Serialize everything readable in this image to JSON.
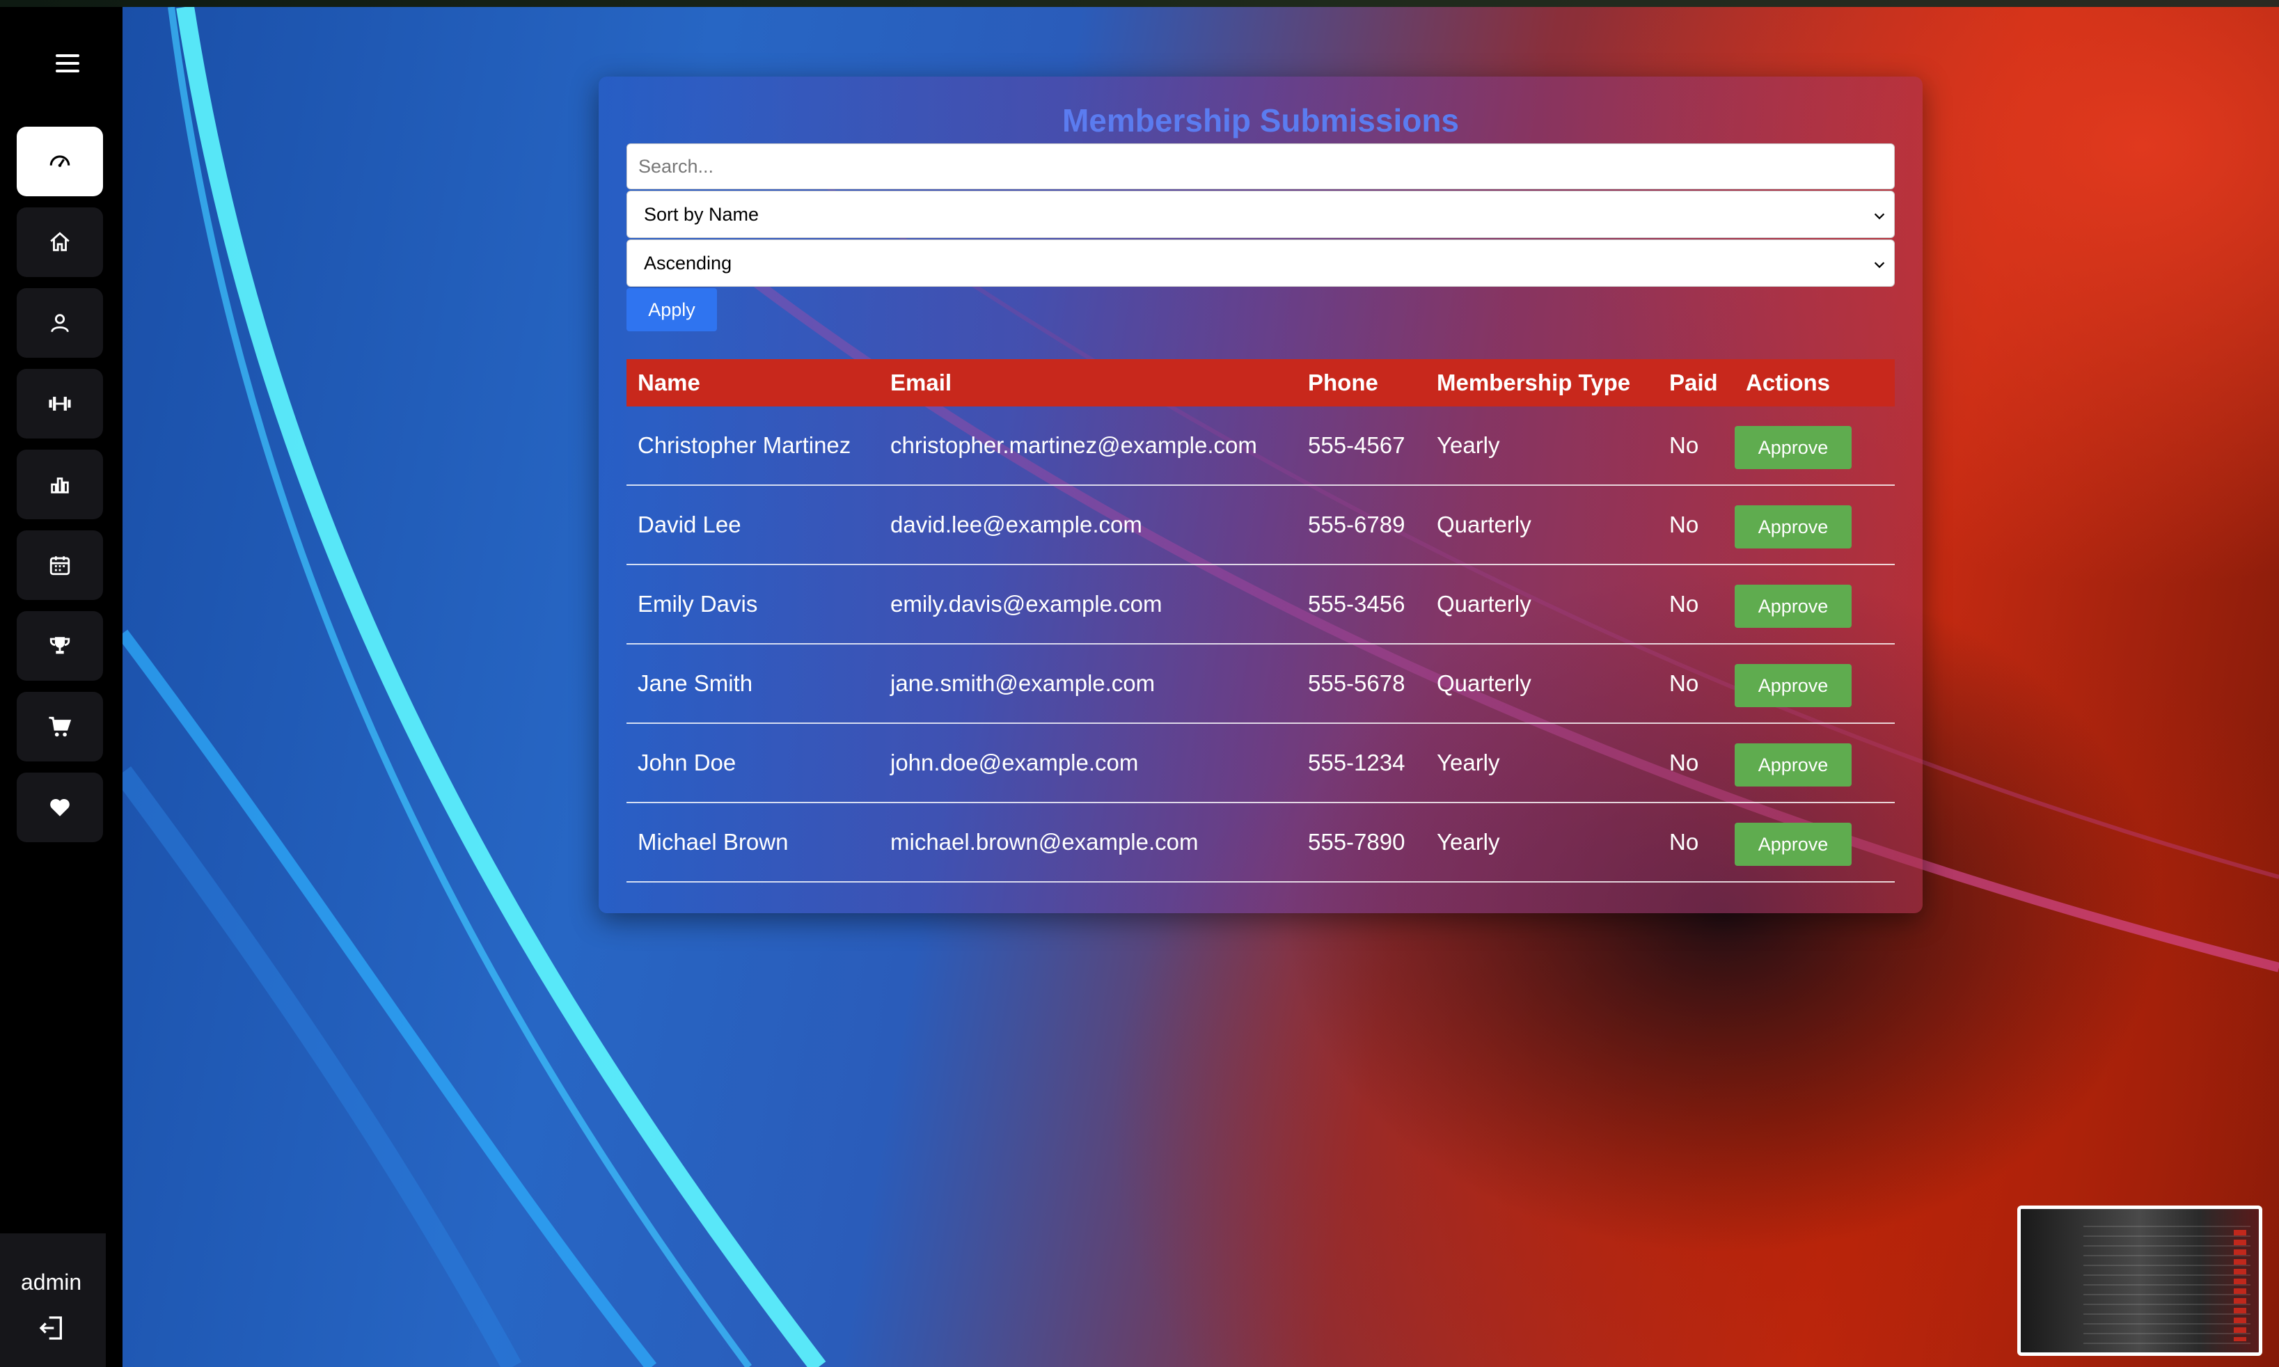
{
  "sidebar": {
    "items": [
      {
        "icon": "dashboard-icon"
      },
      {
        "icon": "home-icon"
      },
      {
        "icon": "user-icon"
      },
      {
        "icon": "dumbbell-icon"
      },
      {
        "icon": "bar-chart-icon"
      },
      {
        "icon": "calendar-icon"
      },
      {
        "icon": "trophy-icon"
      },
      {
        "icon": "cart-icon"
      },
      {
        "icon": "heart-icon"
      }
    ],
    "user": "admin"
  },
  "card": {
    "title": "Membership Submissions",
    "search_placeholder": "Search...",
    "sort_field": "Sort by Name",
    "sort_order": "Ascending",
    "apply_label": "Apply"
  },
  "table": {
    "columns": [
      "Name",
      "Email",
      "Phone",
      "Membership Type",
      "Paid",
      "Actions"
    ],
    "rows": [
      {
        "name": "Christopher Martinez",
        "email": "christopher.martinez@example.com",
        "phone": "555-4567",
        "type": "Yearly",
        "paid": "No",
        "action": "Approve"
      },
      {
        "name": "David Lee",
        "email": "david.lee@example.com",
        "phone": "555-6789",
        "type": "Quarterly",
        "paid": "No",
        "action": "Approve"
      },
      {
        "name": "Emily Davis",
        "email": "emily.davis@example.com",
        "phone": "555-3456",
        "type": "Quarterly",
        "paid": "No",
        "action": "Approve"
      },
      {
        "name": "Jane Smith",
        "email": "jane.smith@example.com",
        "phone": "555-5678",
        "type": "Quarterly",
        "paid": "No",
        "action": "Approve"
      },
      {
        "name": "John Doe",
        "email": "john.doe@example.com",
        "phone": "555-1234",
        "type": "Yearly",
        "paid": "No",
        "action": "Approve"
      },
      {
        "name": "Michael Brown",
        "email": "michael.brown@example.com",
        "phone": "555-7890",
        "type": "Yearly",
        "paid": "No",
        "action": "Approve"
      }
    ]
  },
  "colors": {
    "title": "#5b7cf0",
    "header_bg": "#c8281c",
    "apply_bg": "#2f74f0",
    "approve_bg": "#5fac4f"
  }
}
